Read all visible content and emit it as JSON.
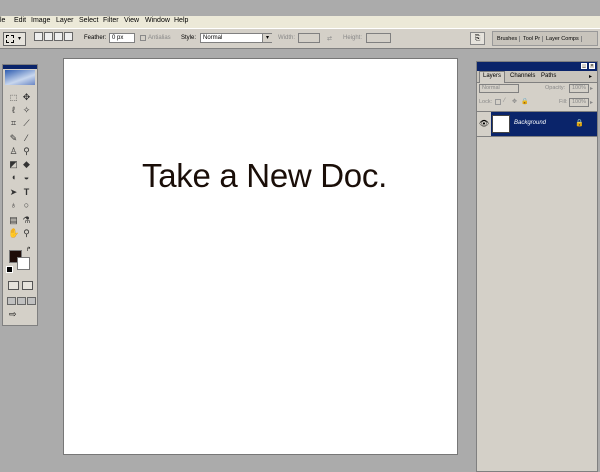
{
  "menu": [
    "le",
    "Edit",
    "Image",
    "Layer",
    "Select",
    "Filter",
    "View",
    "Window",
    "Help"
  ],
  "options": {
    "feather_label": "Feather:",
    "feather_value": "0 px",
    "antialias_label": "Antialias",
    "style_label": "Style:",
    "style_value": "Normal",
    "width_label": "Width:",
    "height_label": "Height:"
  },
  "palette_well": [
    "Brushes",
    "Tool Pr",
    "Layer Comps"
  ],
  "document": {
    "text": "Take a New Doc."
  },
  "colors": {
    "foreground": "#1e0c08",
    "background": "#ffffff",
    "selection": "#0a246a"
  },
  "layers_panel": {
    "tabs": [
      "Layers",
      "Channels",
      "Paths"
    ],
    "blend_mode": "Normal",
    "opacity_label": "Opacity:",
    "opacity_value": "100%",
    "lock_label": "Lock:",
    "fill_label": "Fill:",
    "fill_value": "100%",
    "layer_name": "Background"
  }
}
